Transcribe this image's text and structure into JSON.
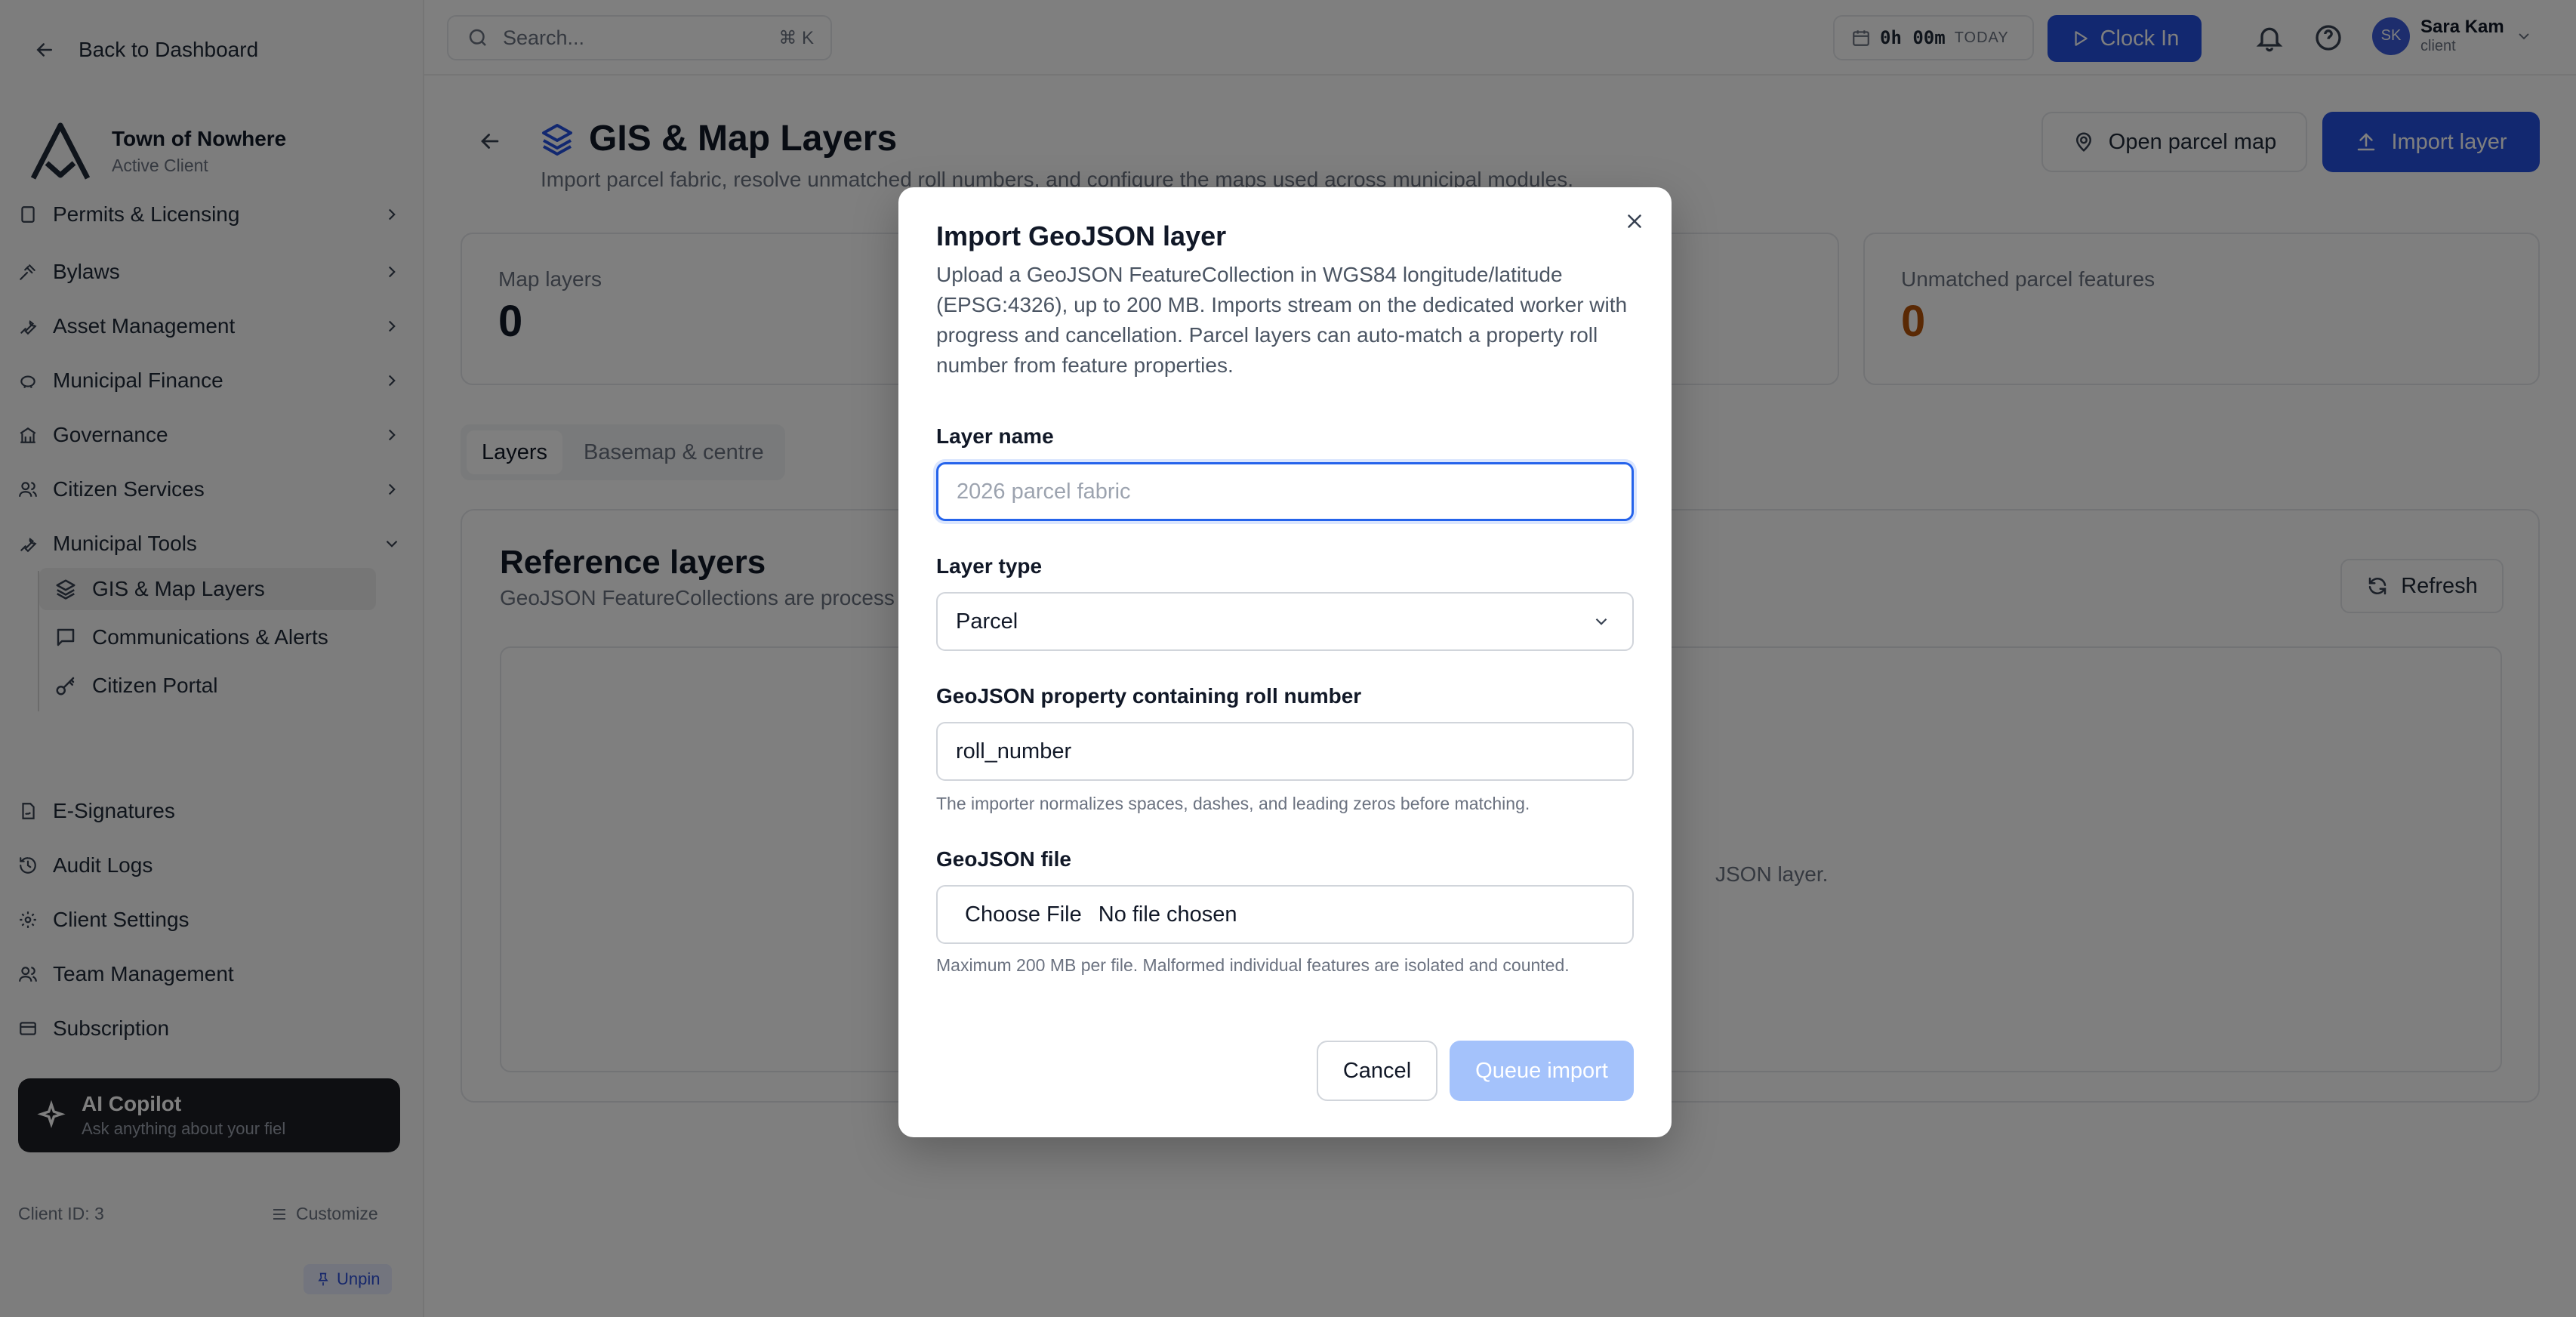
{
  "sidebar": {
    "back_label": "Back to Dashboard",
    "org_name": "Town of Nowhere",
    "org_status": "Active Client",
    "partial_item": "Permits & Licensing",
    "items": [
      {
        "label": "Bylaws",
        "icon": "gavel-icon"
      },
      {
        "label": "Asset Management",
        "icon": "wrench-icon"
      },
      {
        "label": "Municipal Finance",
        "icon": "piggy-bank-icon"
      },
      {
        "label": "Governance",
        "icon": "landmark-icon"
      },
      {
        "label": "Citizen Services",
        "icon": "users-icon"
      },
      {
        "label": "Municipal Tools",
        "icon": "tool-icon"
      }
    ],
    "sub_items": [
      {
        "label": "GIS & Map Layers",
        "icon": "layers-icon",
        "active": true
      },
      {
        "label": "Communications & Alerts",
        "icon": "message-icon",
        "active": false
      },
      {
        "label": "Citizen Portal",
        "icon": "key-icon",
        "active": false
      }
    ],
    "bottom_items": [
      {
        "label": "E-Signatures",
        "icon": "file-signature-icon"
      },
      {
        "label": "Audit Logs",
        "icon": "history-icon"
      },
      {
        "label": "Client Settings",
        "icon": "gear-icon"
      },
      {
        "label": "Team Management",
        "icon": "team-icon"
      },
      {
        "label": "Subscription",
        "icon": "credit-card-icon"
      }
    ],
    "copilot_title": "AI Copilot",
    "copilot_sub": "Ask anything about your fiel",
    "client_id": "Client ID: 3",
    "customize_label": "Customize",
    "unpin_label": "Unpin"
  },
  "topbar": {
    "search_placeholder": "Search...",
    "search_shortcut": "⌘ K",
    "timer_value": "0h 00m",
    "timer_label": "TODAY",
    "clock_in_label": "Clock In",
    "user_name": "Sara Kam",
    "user_role": "client",
    "user_initials": "SK"
  },
  "page": {
    "title": "GIS & Map Layers",
    "subtitle": "Import parcel fabric, resolve unmatched roll numbers, and configure the maps used across municipal modules.",
    "open_parcel_map_label": "Open parcel map",
    "import_layer_label": "Import layer",
    "stats": [
      {
        "label": "Map layers",
        "value": "0"
      },
      {
        "label": "Unmatched parcel features",
        "value": "0"
      }
    ],
    "tabs": [
      "Layers",
      "Basemap & centre"
    ],
    "ref_title": "Reference layers",
    "ref_subtitle": "GeoJSON FeatureCollections are process",
    "refresh_label": "Refresh",
    "empty_fragment": "JSON layer."
  },
  "modal": {
    "title": "Import GeoJSON layer",
    "description": "Upload a GeoJSON FeatureCollection in WGS84 longitude/latitude (EPSG:4326), up to 200 MB. Imports stream on the dedicated worker with progress and cancellation. Parcel layers can auto-match a property roll number from feature properties.",
    "layer_name_label": "Layer name",
    "layer_name_placeholder": "2026 parcel fabric",
    "layer_type_label": "Layer type",
    "layer_type_value": "Parcel",
    "roll_property_label": "GeoJSON property containing roll number",
    "roll_property_value": "roll_number",
    "roll_property_help": "The importer normalizes spaces, dashes, and leading zeros before matching.",
    "file_label": "GeoJSON file",
    "file_button": "Choose File",
    "file_status": "No file chosen",
    "file_help": "Maximum 200 MB per file. Malformed individual features are isolated and counted.",
    "cancel_label": "Cancel",
    "queue_label": "Queue import"
  },
  "colors": {
    "primary": "#2550e0",
    "primary_disabled": "#a4c2fb",
    "focus_ring": "#2563eb",
    "warn_value": "#b45309"
  }
}
